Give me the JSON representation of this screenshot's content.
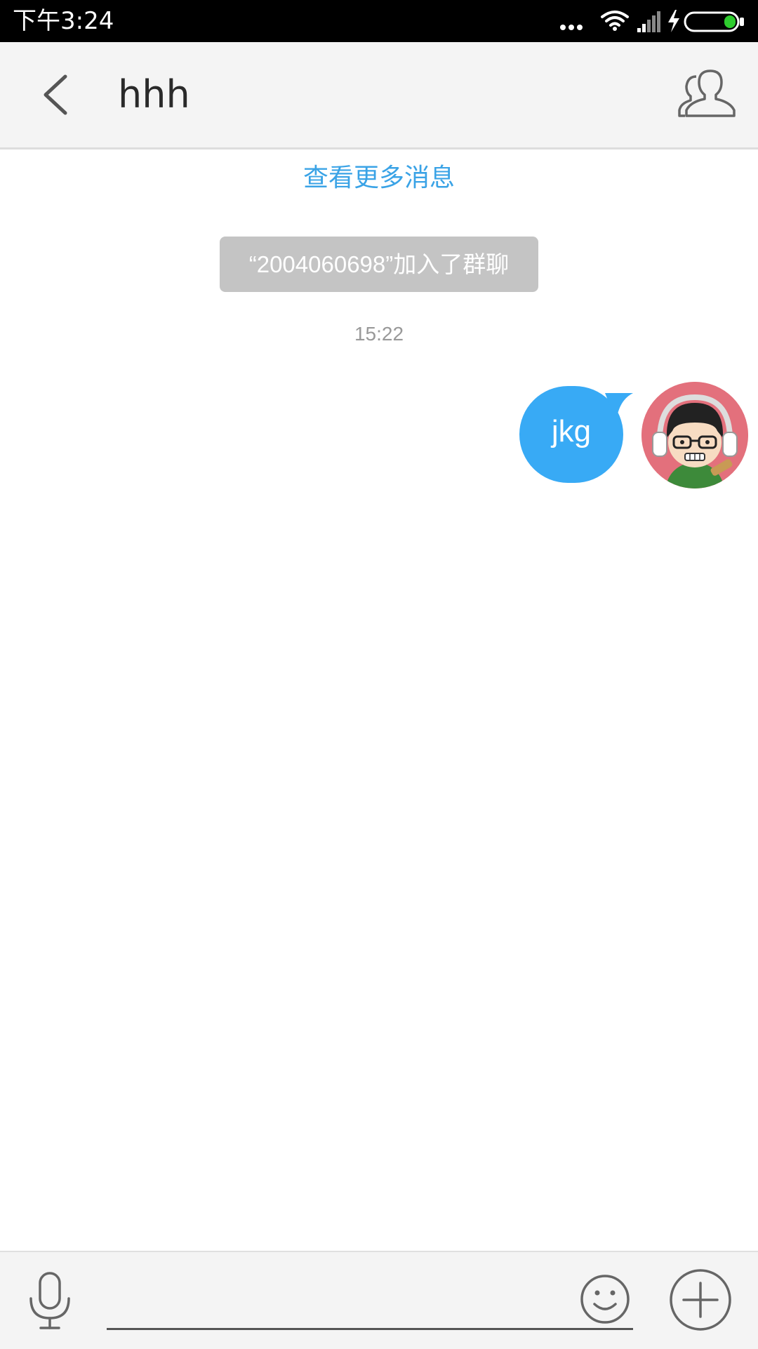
{
  "status_bar": {
    "time": "下午3:24",
    "icons": [
      "more-dots-icon",
      "wifi-icon",
      "signal-icon",
      "charging-icon",
      "battery-icon"
    ],
    "battery_color": "#2ecc2e"
  },
  "header": {
    "title": "hhh",
    "back_icon": "back-arrow-icon",
    "group_icon": "group-members-icon"
  },
  "messages": {
    "load_more": "查看更多消息",
    "system_notice": "“2004060698”加入了群聊",
    "timestamp": "15:22",
    "outgoing": [
      {
        "text": "jkg",
        "avatar": "cartoon-avatar"
      }
    ]
  },
  "input_bar": {
    "message_value": "",
    "voice_icon": "microphone-icon",
    "emoji_icon": "smiley-icon",
    "plus_icon": "plus-circle-icon"
  },
  "colors": {
    "accent": "#3aa3e6",
    "bubble": "#38aaf5",
    "notice_bg": "#c4c4c4",
    "header_bg": "#f4f4f4"
  }
}
